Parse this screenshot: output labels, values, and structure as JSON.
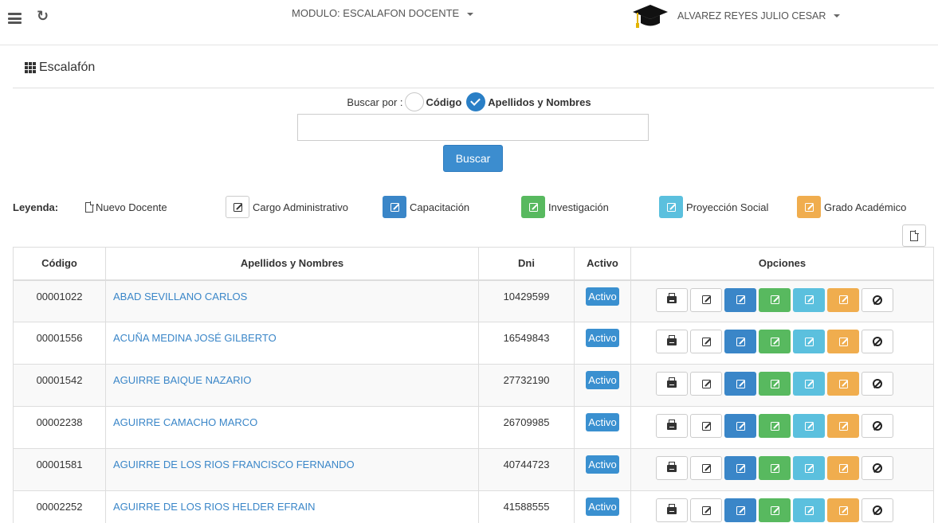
{
  "topbar": {
    "module_label": "MODULO: ESCALAFON DOCENTE",
    "user_name": "ALVAREZ REYES JULIO CESAR"
  },
  "page": {
    "title": "Escalafón"
  },
  "search": {
    "label": "Buscar por :",
    "option_code": "Código",
    "option_names": "Apellidos y Nombres",
    "selected": "Apellidos y Nombres",
    "value": "",
    "button": "Buscar"
  },
  "legend": {
    "title": "Leyenda:",
    "nuevo_docente": "Nuevo Docente",
    "cargo": "Cargo Administrativo",
    "capacitacion": "Capacitación",
    "investigacion": "Investigación",
    "proyeccion": "Proyección Social",
    "grado": "Grado Académico"
  },
  "colors": {
    "blue": "#3a86c8",
    "green": "#58b95f",
    "cyan": "#5bc0de",
    "orange": "#f0ad4e"
  },
  "table": {
    "headers": [
      "Código",
      "Apellidos y Nombres",
      "Dni",
      "Activo",
      "Opciones"
    ],
    "rows": [
      {
        "codigo": "00001022",
        "nombre": "ABAD SEVILLANO CARLOS",
        "dni": "10429599",
        "activo": "Activo"
      },
      {
        "codigo": "00001556",
        "nombre": "ACUÑA MEDINA JOSÉ GILBERTO",
        "dni": "16549843",
        "activo": "Activo"
      },
      {
        "codigo": "00001542",
        "nombre": "AGUIRRE BAIQUE NAZARIO",
        "dni": "27732190",
        "activo": "Activo"
      },
      {
        "codigo": "00002238",
        "nombre": "AGUIRRE CAMACHO MARCO",
        "dni": "26709985",
        "activo": "Activo"
      },
      {
        "codigo": "00001581",
        "nombre": "AGUIRRE DE LOS RIOS FRANCISCO FERNANDO",
        "dni": "40744723",
        "activo": "Activo"
      },
      {
        "codigo": "00002252",
        "nombre": "AGUIRRE DE LOS RIOS HELDER EFRAIN",
        "dni": "41588555",
        "activo": "Activo"
      }
    ]
  }
}
